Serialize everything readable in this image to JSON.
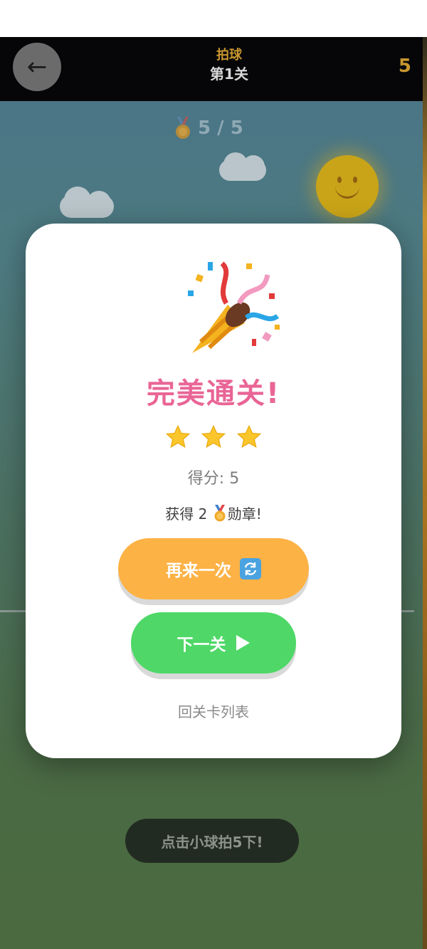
{
  "header": {
    "back_arrow": "←",
    "game_name": "拍球",
    "level_name": "第1关",
    "score": "5"
  },
  "progress": {
    "icon": "medal-icon",
    "text": "5 / 5"
  },
  "hint": {
    "text": "点击小球拍5下!"
  },
  "modal": {
    "icon": "party-popper-icon",
    "title": "完美通关!",
    "stars": 3,
    "score_text": "得分: 5",
    "medal_prefix": "获得 2 ",
    "medal_suffix": "勋章!",
    "retry_label": "再来一次",
    "retry_icon": "refresh-icon",
    "next_label": "下一关",
    "next_icon": "play-icon",
    "back_list_label": "回关卡列表"
  },
  "colors": {
    "title": "#e96595",
    "retry": "#fdb245",
    "next": "#4fd867",
    "header_gold": "#c8962f"
  }
}
